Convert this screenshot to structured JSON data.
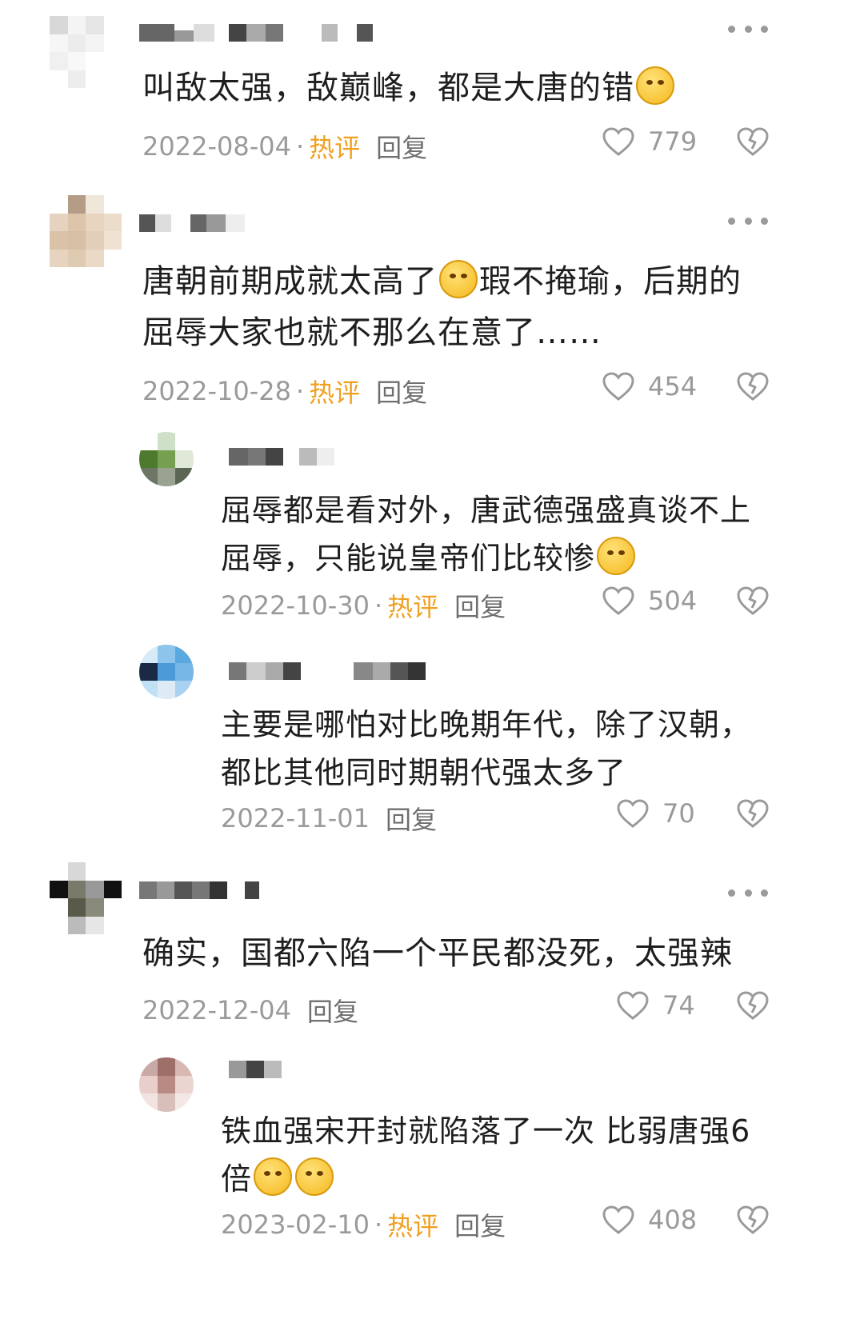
{
  "comments": [
    {
      "text_before": "叫敌太强，敌巅峰，都是大唐的错",
      "emoji_after": "sad-tears-emoji",
      "date": "2022-08-04",
      "dot": "·",
      "hot": "热评",
      "reply": "回复",
      "likes": "779"
    },
    {
      "text_line1_before": "唐朝前期成就太高了",
      "emoji_mid": "crying-laughing-emoji",
      "text_line1_after": "瑕不掩瑜，后期的",
      "text_line2": "屈辱大家也就不那么在意了……",
      "date": "2022-10-28",
      "dot": "·",
      "hot": "热评",
      "reply": "回复",
      "likes": "454"
    },
    {
      "text_line1": "屈辱都是看对外，唐武德强盛真谈不上",
      "text_line2": "屈辱，只能说皇帝们比较惨",
      "emoji_after": "tongue-out-emoji",
      "date": "2022-10-30",
      "dot": "·",
      "hot": "热评",
      "reply": "回复",
      "likes": "504"
    },
    {
      "text_line1": "主要是哪怕对比晚期年代，除了汉朝，",
      "text_line2": "都比其他同时期朝代强太多了",
      "date": "2022-11-01",
      "reply": "回复",
      "likes": "70"
    },
    {
      "text_line1": "确实，国都六陷一个平民都没死，太强辣",
      "date": "2022-12-04",
      "reply": "回复",
      "likes": "74"
    },
    {
      "text_line1": "铁血强宋开封就陷落了一次 比弱唐强6",
      "text_line2": "倍",
      "emoji_after": "rolling-laughing-emoji",
      "date": "2023-02-10",
      "dot": "·",
      "hot": "热评",
      "reply": "回复",
      "likes": "408"
    }
  ],
  "colors": {
    "text": "#1e1e1e",
    "meta": "#9a9a9a",
    "hot": "#f0a020",
    "reply": "#6f6f6f"
  },
  "icons": [
    "more-icon",
    "heart-icon",
    "dislike-icon"
  ]
}
